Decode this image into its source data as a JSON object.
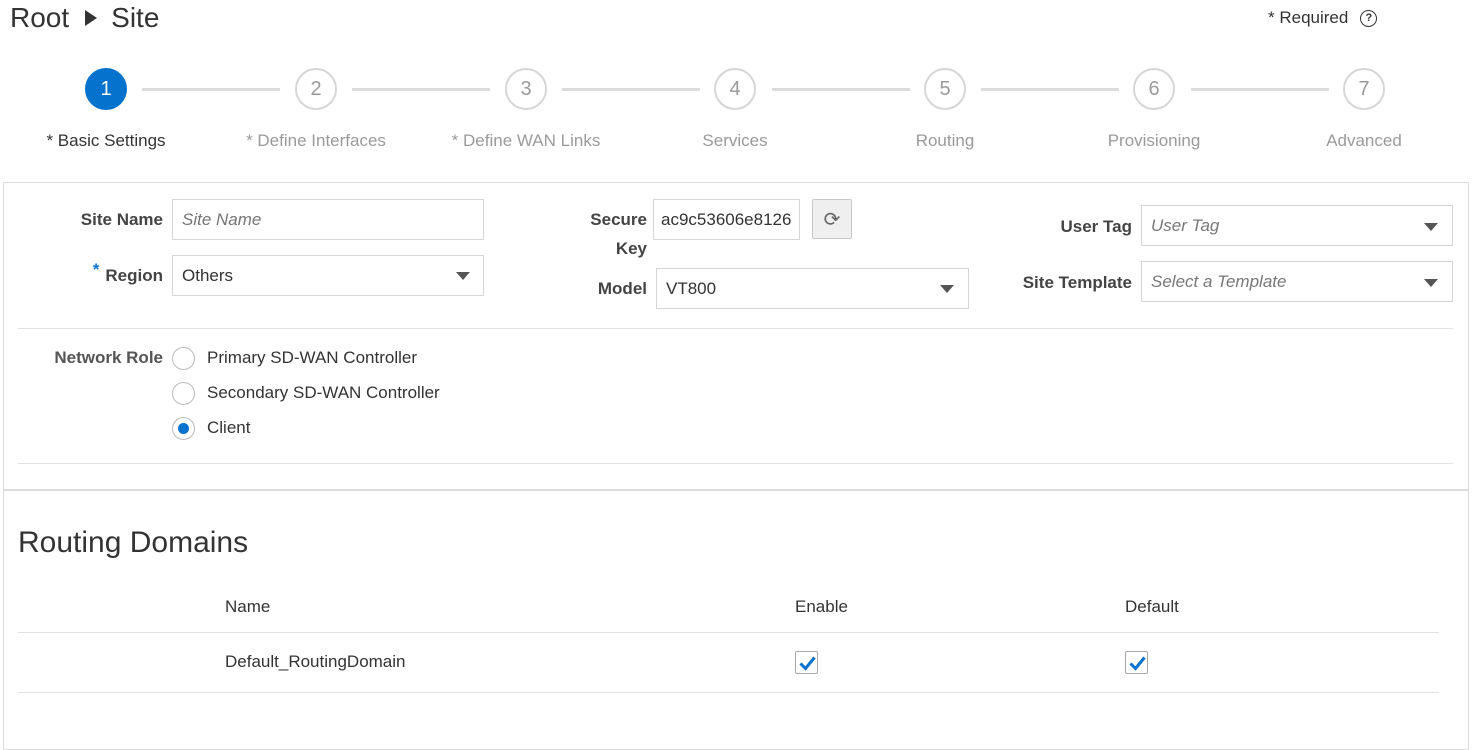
{
  "breadcrumb": {
    "root": "Root",
    "current": "Site"
  },
  "required_note": "* Required",
  "help_icon": "question-circle-icon",
  "steps": [
    {
      "number": "1",
      "label": "* Basic Settings"
    },
    {
      "number": "2",
      "label": "* Define Interfaces"
    },
    {
      "number": "3",
      "label": "* Define WAN Links"
    },
    {
      "number": "4",
      "label": "Services"
    },
    {
      "number": "5",
      "label": "Routing"
    },
    {
      "number": "6",
      "label": "Provisioning"
    },
    {
      "number": "7",
      "label": "Advanced"
    }
  ],
  "active_step": 1,
  "form": {
    "site_name_label": "Site Name",
    "site_name_placeholder": "Site Name",
    "region_required_marker": "*",
    "region_label": "Region",
    "region_value": "Others",
    "secure_key_label_line1": "Secure",
    "secure_key_label_line2": "Key",
    "secure_key_value": "ac9c53606e8126",
    "refresh_icon": "refresh-icon",
    "model_label": "Model",
    "model_value": "VT800",
    "user_tag_label": "User Tag",
    "user_tag_placeholder": "User Tag",
    "site_template_label": "Site Template",
    "site_template_placeholder": "Select a Template",
    "network_role_label": "Network Role",
    "network_roles": [
      {
        "label": "Primary SD-WAN Controller",
        "selected": false
      },
      {
        "label": "Secondary SD-WAN Controller",
        "selected": false
      },
      {
        "label": "Client",
        "selected": true
      }
    ]
  },
  "routing_domains": {
    "title": "Routing Domains",
    "columns": [
      "Name",
      "Enable",
      "Default"
    ],
    "rows": [
      {
        "name": "Default_RoutingDomain",
        "enable": true,
        "default": true
      }
    ]
  },
  "colors": {
    "accent": "#0572ce",
    "border": "#dcdcdc"
  }
}
